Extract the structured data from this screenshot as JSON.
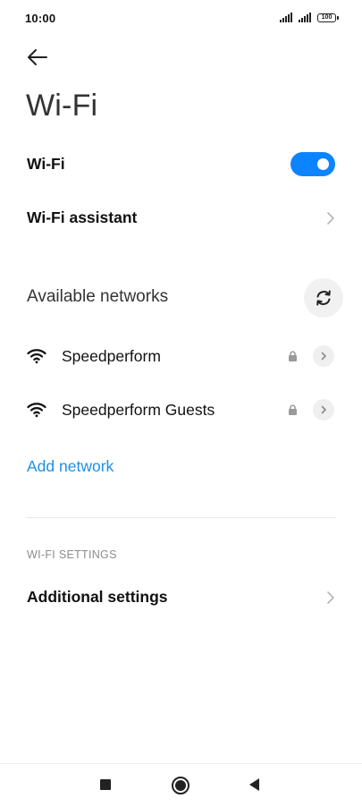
{
  "status_bar": {
    "time": "10:00",
    "battery": "100",
    "icons": [
      "signal-icon",
      "signal-icon",
      "battery-icon"
    ]
  },
  "header": {
    "back_icon": "arrow-left-icon",
    "title": "Wi-Fi"
  },
  "wifi_toggle": {
    "label": "Wi-Fi",
    "enabled": true,
    "accent": "#0d84ff"
  },
  "wifi_assistant": {
    "label": "Wi-Fi assistant",
    "icon": "chevron-right-icon"
  },
  "available_networks": {
    "title": "Available networks",
    "refresh_icon": "refresh-icon",
    "networks": [
      {
        "name": "Speedperform",
        "secured": true
      },
      {
        "name": "Speedperform Guests",
        "secured": true
      }
    ]
  },
  "add_network": {
    "label": "Add network",
    "color": "#1e8fe6"
  },
  "settings_section": {
    "header": "WI-FI SETTINGS",
    "additional_label": "Additional settings"
  },
  "nav_bar": {
    "buttons": [
      "recents-square-icon",
      "home-circle-icon",
      "back-triangle-icon"
    ]
  }
}
